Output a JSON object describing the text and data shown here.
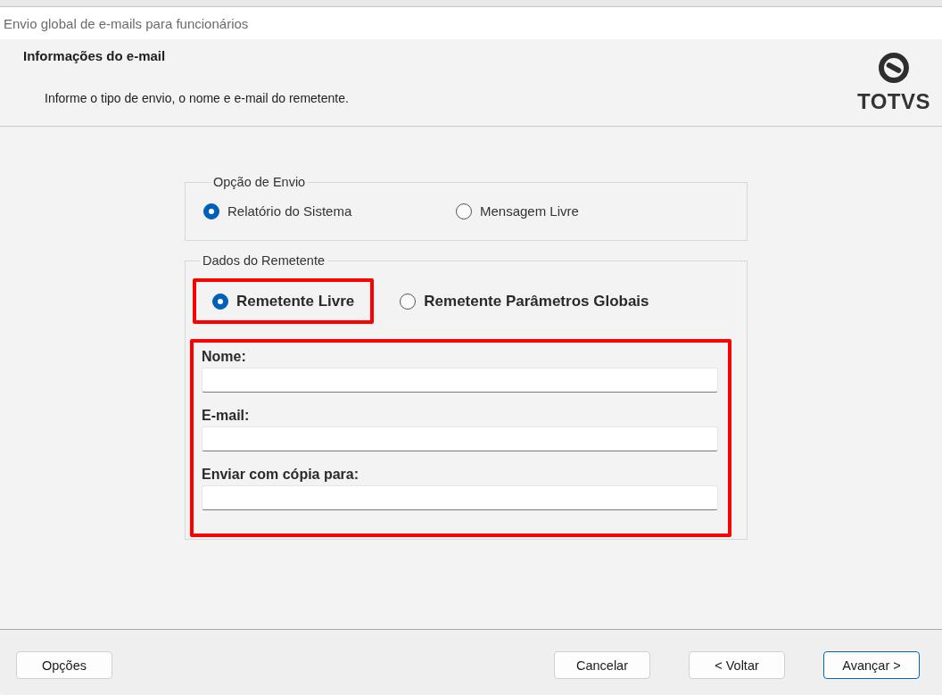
{
  "window": {
    "title": "Envio global de e-mails para funcionários"
  },
  "header": {
    "title": "Informações do e-mail",
    "subtitle": "Informe o tipo de envio, o nome e e-mail do remetente.",
    "logo_text": "TOTVS"
  },
  "send_option": {
    "legend": "Opção de Envio",
    "options": [
      {
        "label": "Relatório do Sistema",
        "selected": true
      },
      {
        "label": "Mensagem Livre",
        "selected": false
      }
    ]
  },
  "sender": {
    "legend": "Dados do Remetente",
    "options": [
      {
        "label": "Remetente Livre",
        "selected": true,
        "highlighted": true
      },
      {
        "label": "Remetente Parâmetros Globais",
        "selected": false,
        "highlighted": false
      }
    ],
    "fields_highlighted": true,
    "fields": [
      {
        "label": "Nome:"
      },
      {
        "label": "E-mail:"
      },
      {
        "label": "Enviar com cópia para:"
      }
    ]
  },
  "footer": {
    "left_buttons": [
      {
        "label": "Opções",
        "default": false
      }
    ],
    "right_buttons": [
      {
        "label": "Cancelar",
        "default": false
      },
      {
        "label": "< Voltar",
        "default": false
      },
      {
        "label": "Avançar >",
        "default": true
      }
    ]
  }
}
